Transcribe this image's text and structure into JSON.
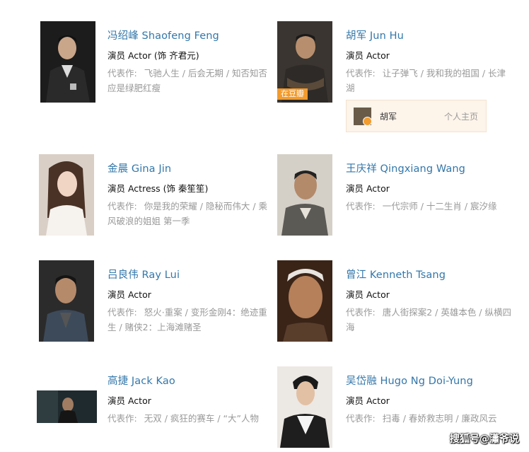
{
  "works_label": "代表作:",
  "people": [
    {
      "name": "冯绍峰 Shaofeng Feng",
      "role": "演员 Actor (饰 齐君元)",
      "works": "飞驰人生 / 后会无期 / 知否知否应是绿肥红瘦"
    },
    {
      "name": "胡军 Jun Hu",
      "role": "演员 Actor",
      "works": "让子弹飞 / 我和我的祖国 / 长津湖",
      "badge": "在豆瓣"
    },
    {
      "name": "金晨 Gina Jin",
      "role": "演员 Actress (饰 秦笙笙)",
      "works": "你是我的荣耀 / 隐秘而伟大 / 乘风破浪的姐姐 第一季"
    },
    {
      "name": "王庆祥 Qingxiang Wang",
      "role": "演员 Actor",
      "works": "一代宗师 / 十二生肖 / 宸汐缘"
    },
    {
      "name": "吕良伟 Ray Lui",
      "role": "演员 Actor",
      "works": "怒火·重案 / 变形金刚4：绝迹重生 / 赌侠2：上海滩赌圣"
    },
    {
      "name": "曾江 Kenneth Tsang",
      "role": "演员 Actor",
      "works": "唐人街探案2 / 英雄本色 / 纵横四海"
    },
    {
      "name": "高捷 Jack Kao",
      "role": "演员 Actor",
      "works": "无双 / 疯狂的赛车 / “大”人物"
    },
    {
      "name": "吴岱融 Hugo Ng Doi-Yung",
      "role": "演员 Actor",
      "works": "扫毒 / 春娇救志明 / 廉政风云"
    }
  ],
  "homepage": {
    "name": "胡军",
    "link": "个人主页"
  },
  "watermark": "搜狐号@瀟爷说"
}
